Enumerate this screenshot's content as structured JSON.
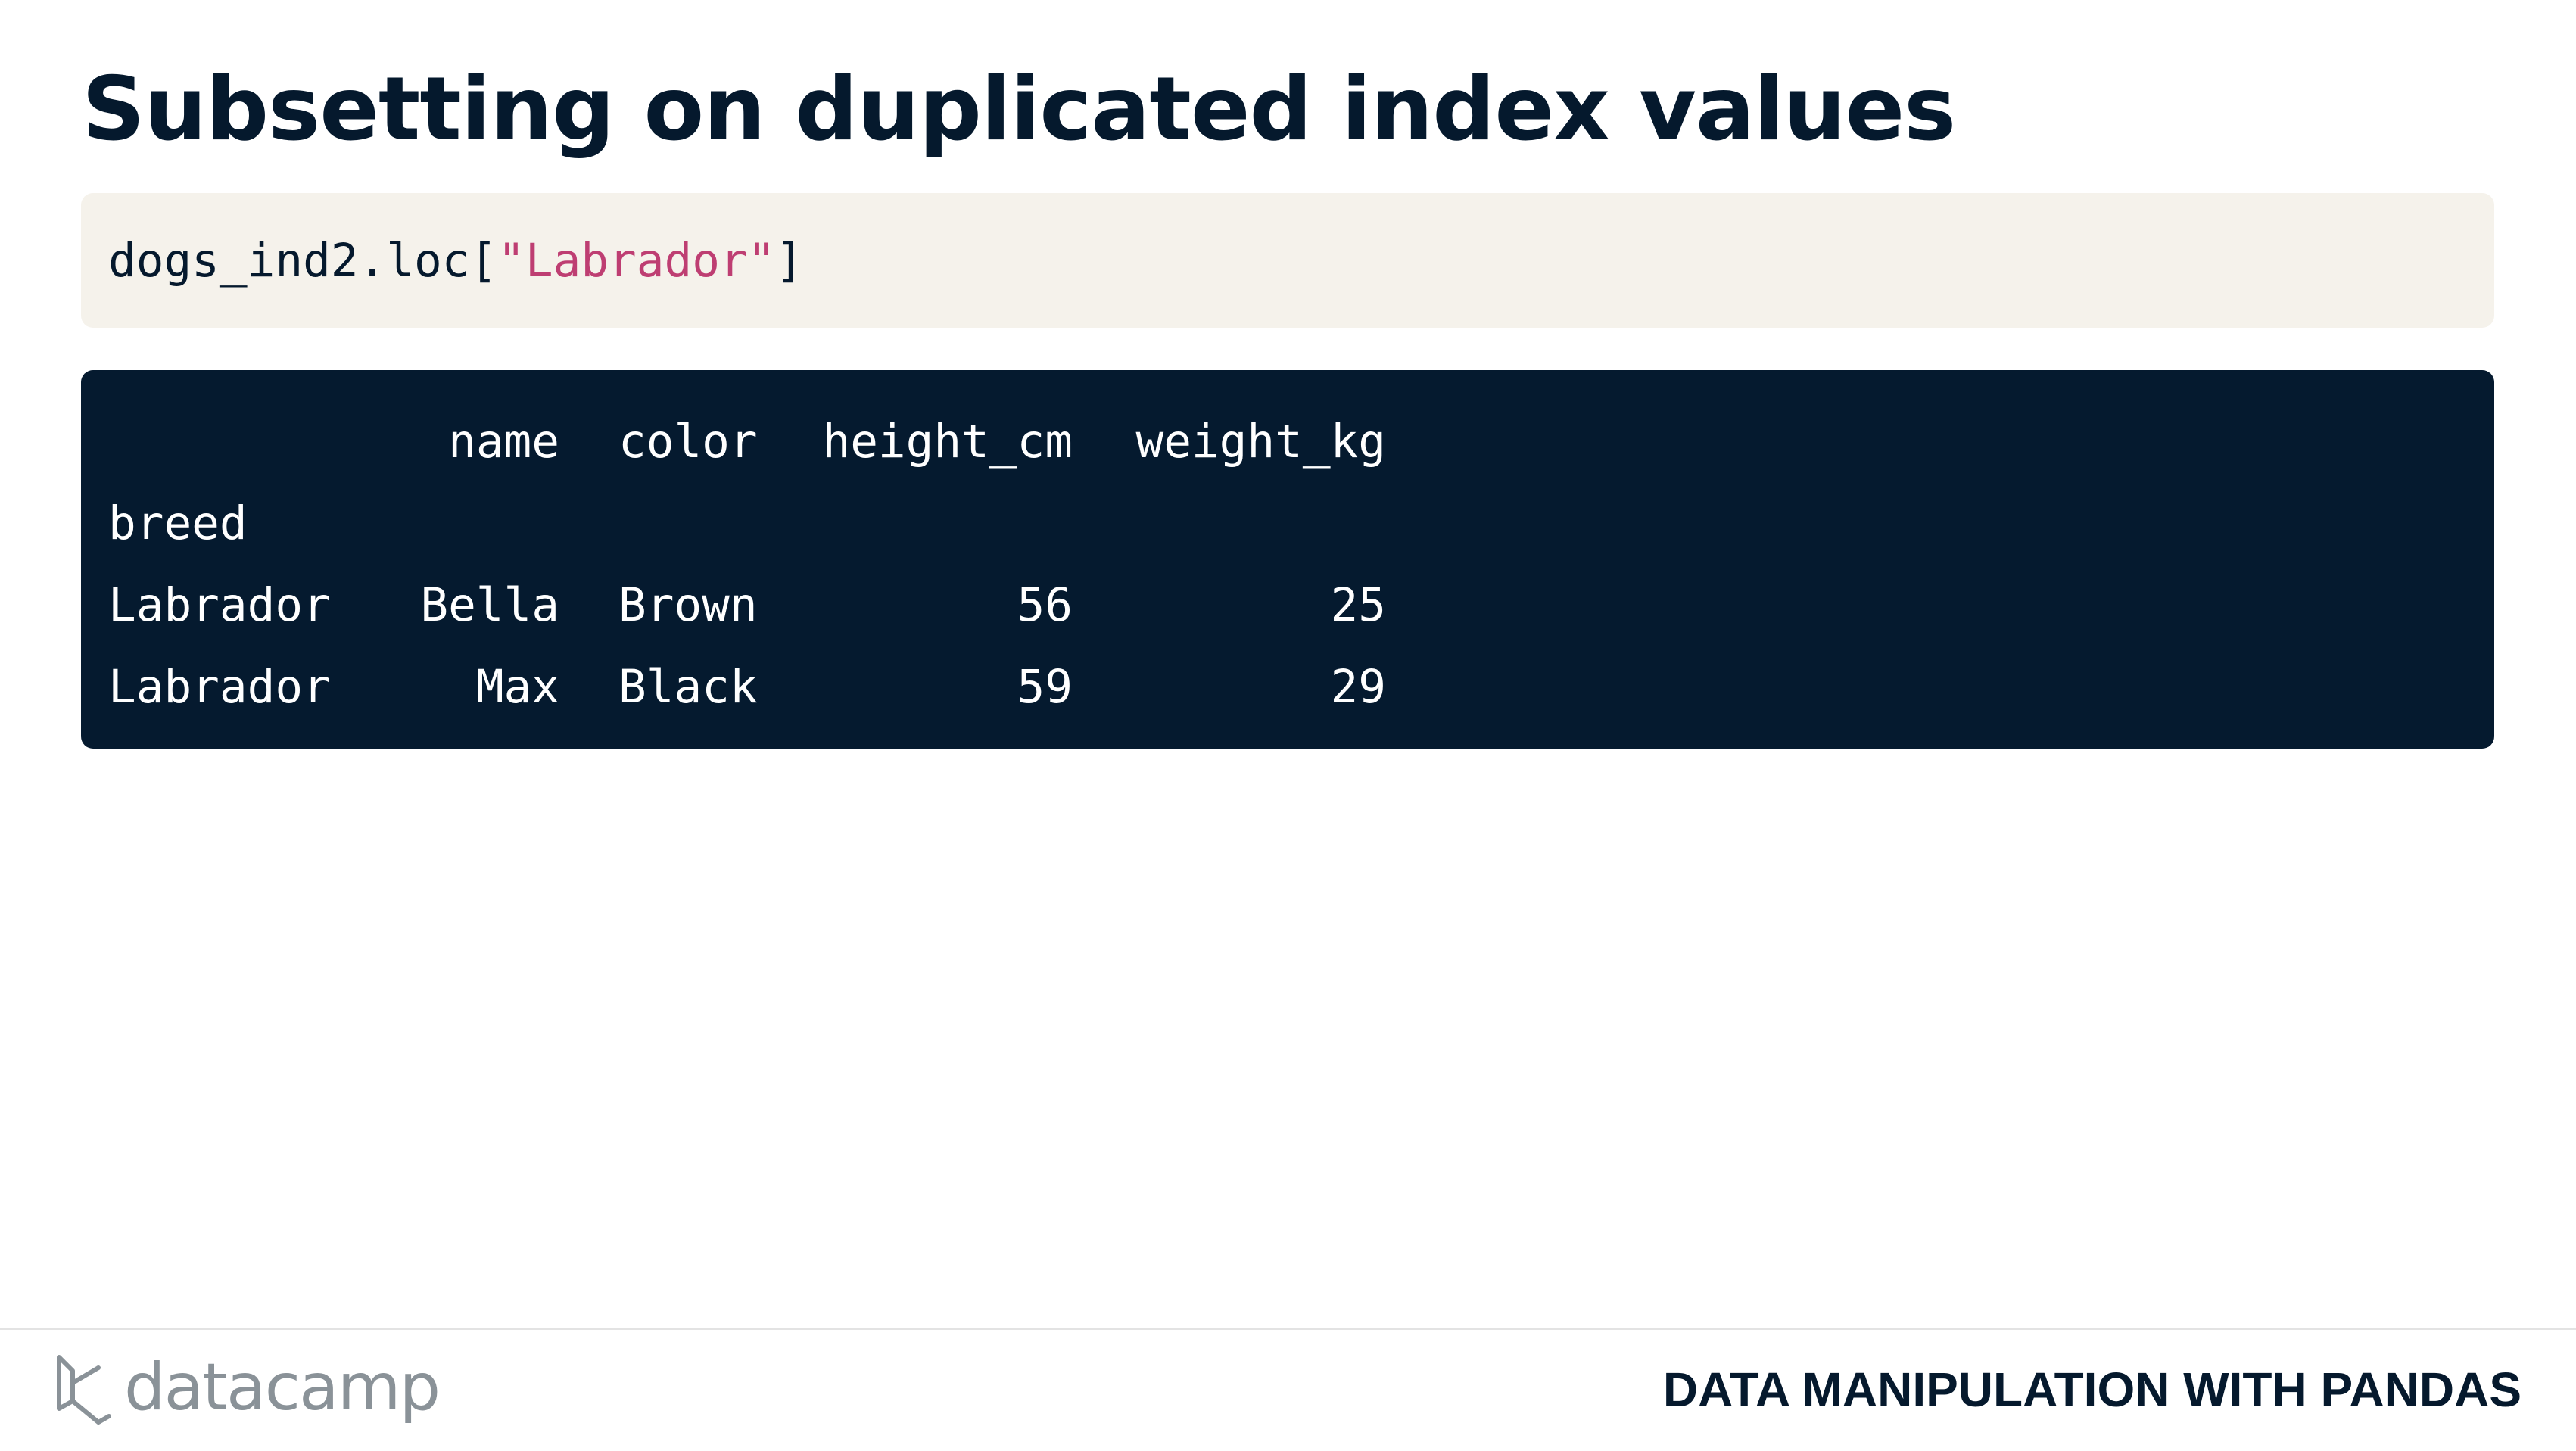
{
  "slide": {
    "title": "Subsetting on duplicated index values"
  },
  "code": {
    "prefix": "dogs_ind2.loc[",
    "string": "\"Labrador\"",
    "suffix": "]"
  },
  "output": {
    "headers": [
      "name",
      "color",
      "height_cm",
      "weight_kg"
    ],
    "index_name": "breed",
    "rows": [
      {
        "index": "Labrador",
        "name": "Bella",
        "color": "Brown",
        "height_cm": "56",
        "weight_kg": "25"
      },
      {
        "index": "Labrador",
        "name": "Max",
        "color": "Black",
        "height_cm": "59",
        "weight_kg": "29"
      }
    ]
  },
  "footer": {
    "logo_text": "datacamp",
    "course_title": "DATA MANIPULATION WITH PANDAS"
  },
  "colors": {
    "title": "#05192d",
    "code_bg": "#f5f2eb",
    "output_bg": "#051a2f",
    "string": "#be3e72",
    "logo": "#8a9298"
  }
}
